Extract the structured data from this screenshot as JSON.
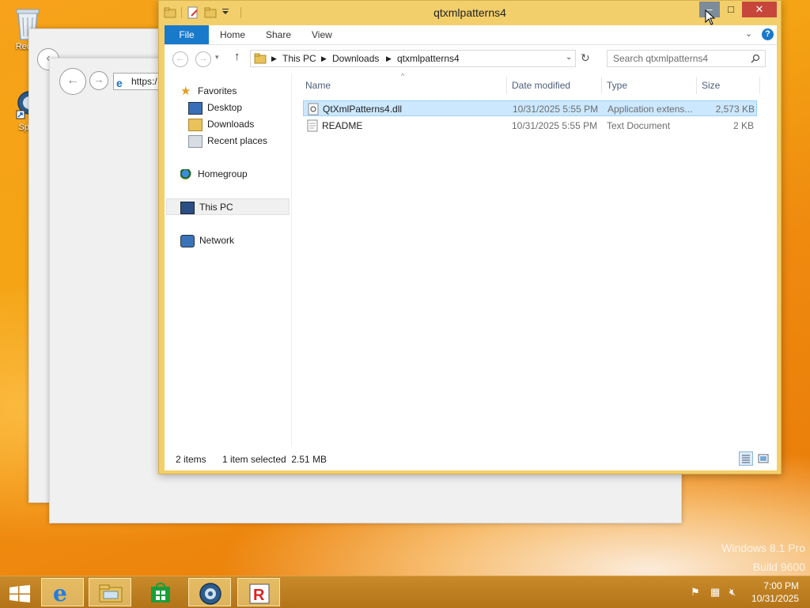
{
  "desktop": {
    "icons": [
      {
        "label": "Recyc",
        "name": "recycle-bin"
      },
      {
        "label": "Sper",
        "name": "shortcut"
      }
    ],
    "watermark": {
      "line1": "Windows 8.1 Pro",
      "line2": "Build 9600"
    }
  },
  "background_window": {
    "address_text": "https:/"
  },
  "explorer": {
    "title": "qtxmlpatterns4",
    "window_buttons": {
      "minimize": "–",
      "maximize": "□",
      "close": "✕"
    },
    "ribbon": {
      "file": "File",
      "home": "Home",
      "share": "Share",
      "view": "View",
      "help": "?"
    },
    "breadcrumb": [
      "This PC",
      "Downloads",
      "qtxmlpatterns4"
    ],
    "search_placeholder": "Search qtxmlpatterns4",
    "nav": {
      "favorites": "Favorites",
      "desktop": "Desktop",
      "downloads": "Downloads",
      "recent": "Recent places",
      "homegroup": "Homegroup",
      "thispc": "This PC",
      "network": "Network"
    },
    "columns": {
      "name": "Name",
      "date": "Date modified",
      "type": "Type",
      "size": "Size"
    },
    "files": [
      {
        "name": "QtXmlPatterns4.dll",
        "date": "10/31/2025 5:55 PM",
        "type": "Application extens...",
        "size": "2,573 KB",
        "selected": true
      },
      {
        "name": "README",
        "date": "10/31/2025 5:55 PM",
        "type": "Text Document",
        "size": "2 KB",
        "selected": false
      }
    ],
    "status": {
      "items": "2 items",
      "selection": "1 item selected  2.51 MB"
    }
  },
  "taskbar": {
    "clock_time": "7:00 PM",
    "clock_date": "10/31/2025"
  },
  "colors": {
    "accent": "#1979ca",
    "window_frame": "#f2cf6b",
    "selection": "#cce8ff",
    "desktop": "#f4a414"
  }
}
